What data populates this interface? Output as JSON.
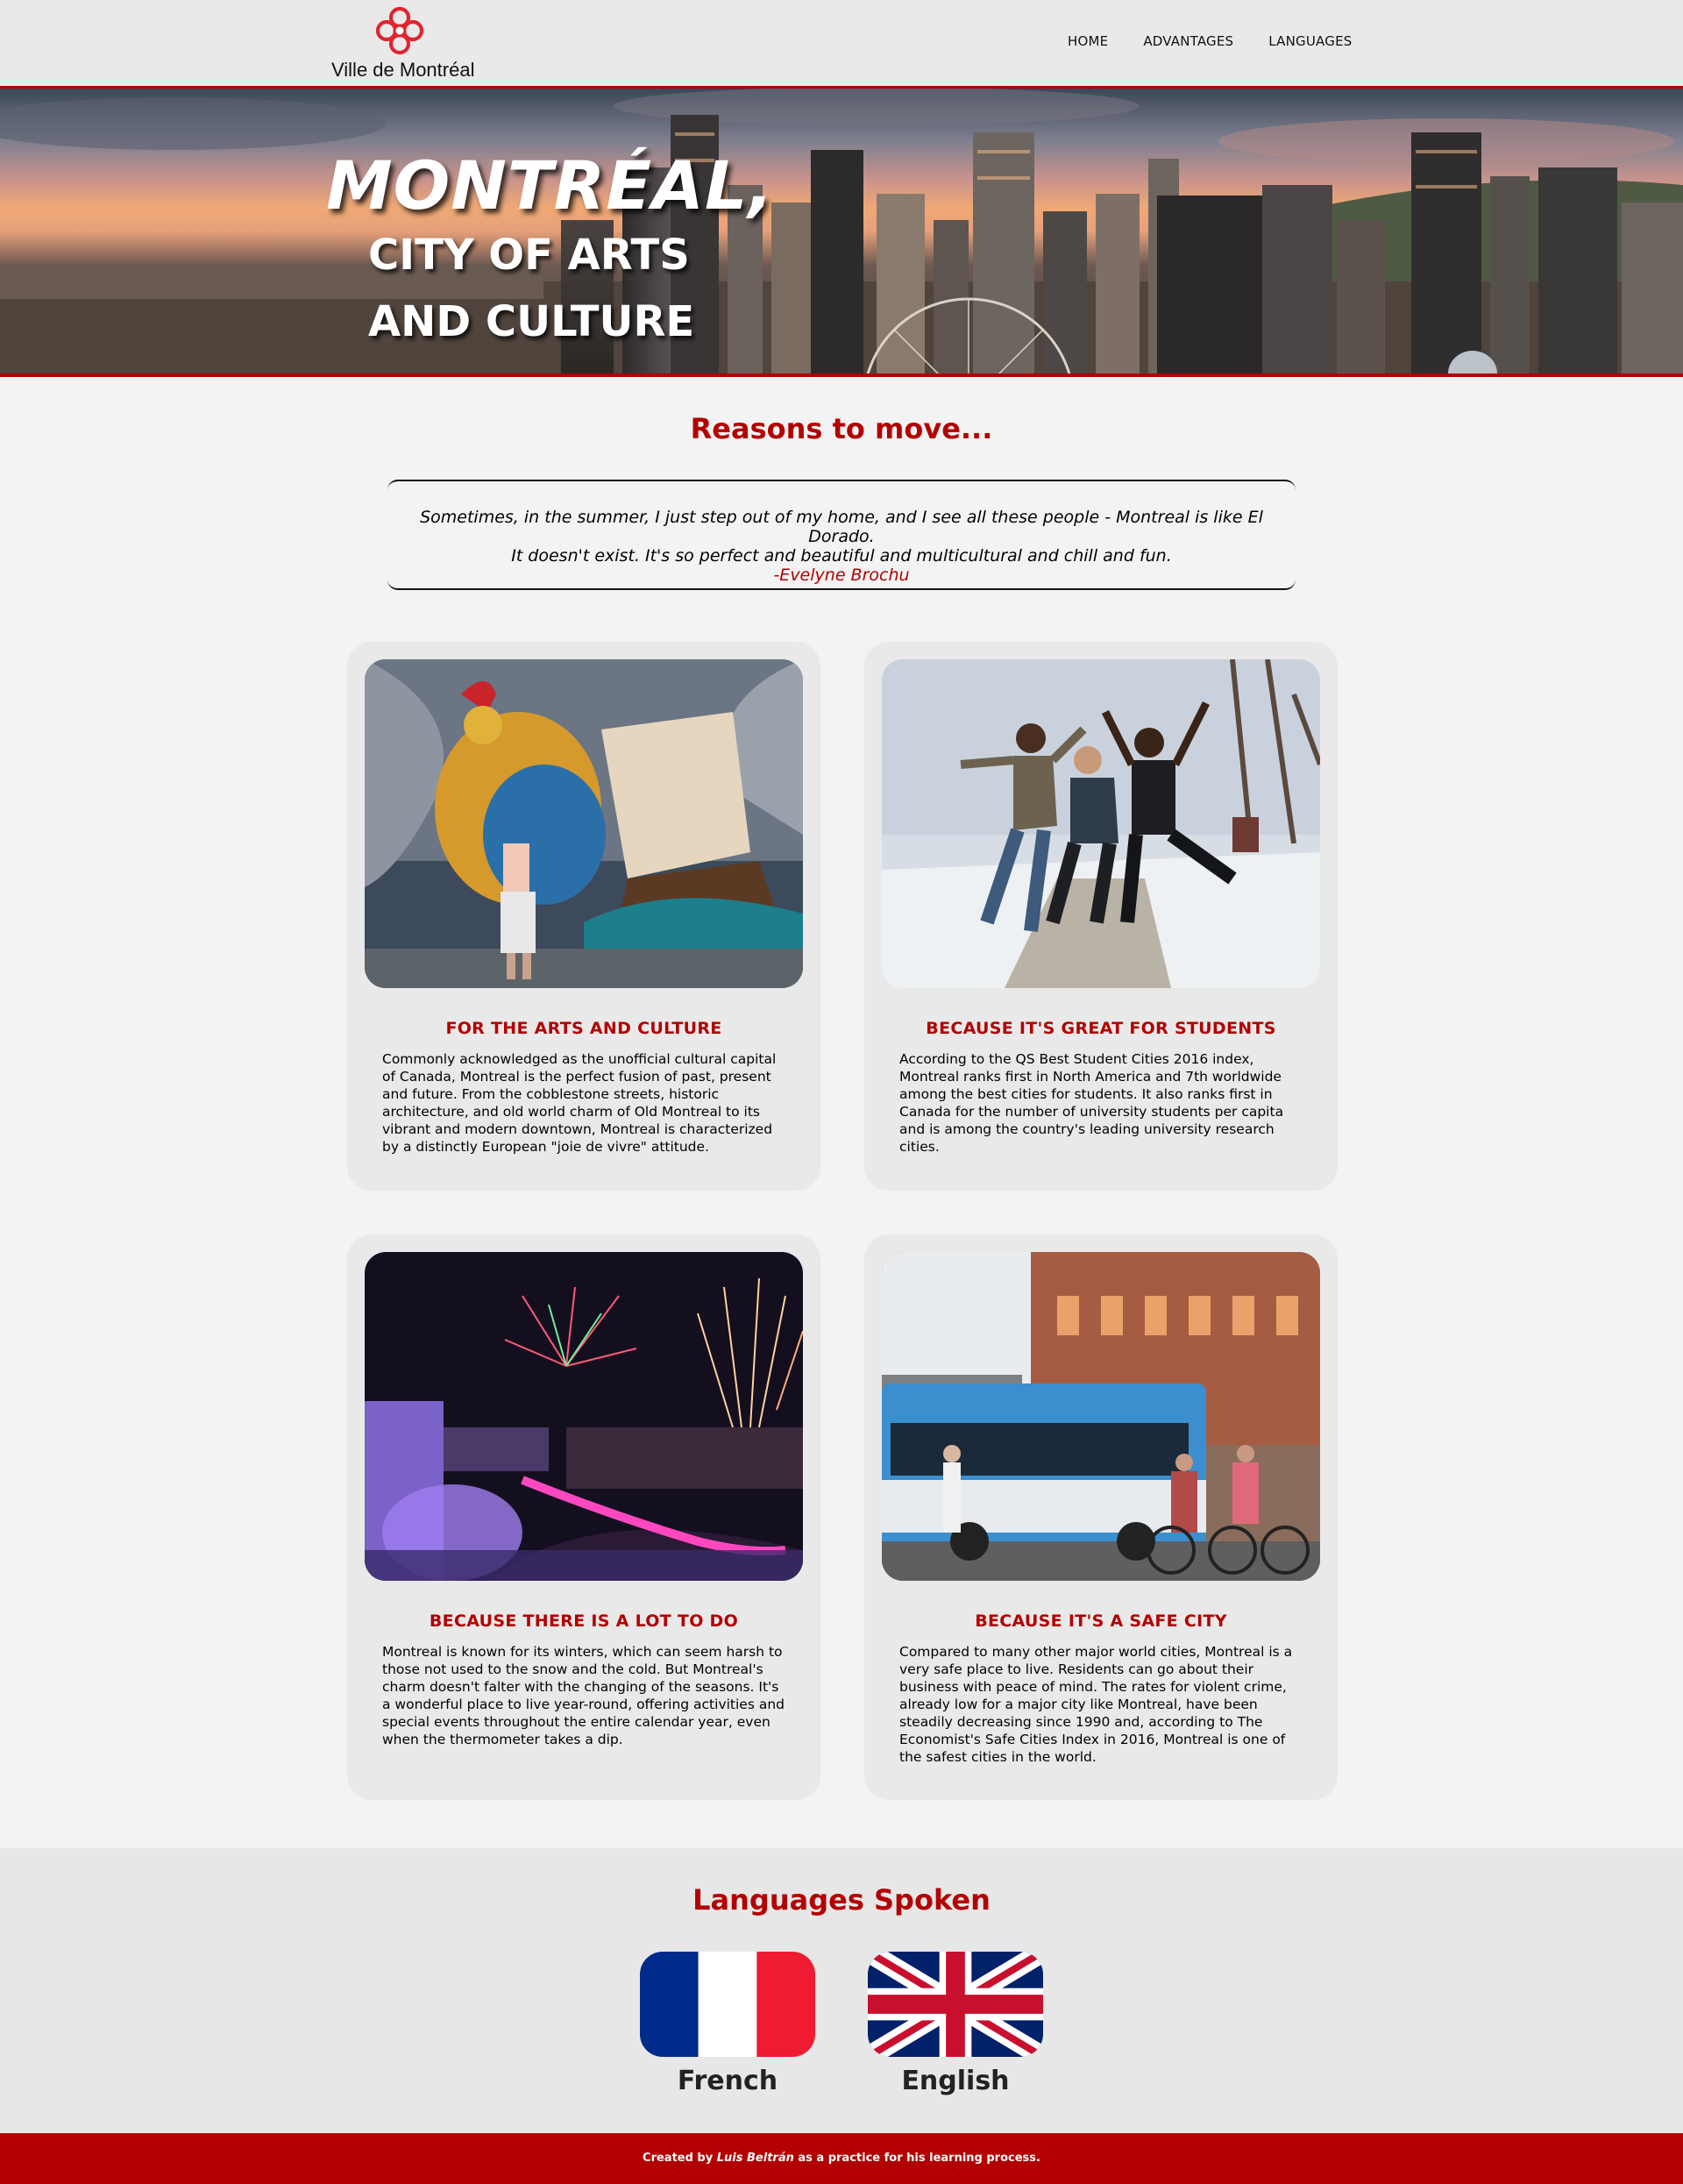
{
  "header": {
    "logo_text": "Ville de Montréal",
    "logo_icon": "rosette-icon",
    "brand_color": "#e0242f",
    "nav": [
      {
        "label": "HOME"
      },
      {
        "label": "ADVANTAGES"
      },
      {
        "label": "LANGUAGES"
      }
    ]
  },
  "hero": {
    "title": "MONTRÉAL,",
    "subtitle_line1": "CITY OF ARTS",
    "subtitle_line2": "AND CULTURE",
    "image": "montreal-skyline-sunset"
  },
  "reasons": {
    "title": "Reasons to move...",
    "quote": {
      "line1": "Sometimes, in the summer, I just step out of my home, and I see all these people - Montreal is like El Dorado.",
      "line2": "It doesn't exist. It's so perfect and beautiful and multicultural and chill and fun.",
      "author": "-Evelyne Brochu"
    },
    "cards": [
      {
        "title": "FOR THE ARTS AND CULTURE",
        "text": "Commonly acknowledged as the unofficial cultural capital of Canada, Montreal is the perfect fusion of past, present and future. From the cobblestone streets, historic architecture, and old world charm of Old Montreal to its vibrant and modern downtown, Montreal is characterized by a distinctly European \"joie de vivre\" attitude.",
        "image": "street-art-mural"
      },
      {
        "title": "BECAUSE IT'S GREAT FOR STUDENTS",
        "text": "According to the QS Best Student Cities 2016 index, Montreal ranks first in North America and 7th worldwide among the best cities for students. It also ranks first in Canada for the number of university students per capita and is among the country's leading university research cities.",
        "image": "students-jumping"
      },
      {
        "title": "BECAUSE THERE IS A LOT TO DO",
        "text": "Montreal is known for its winters, which can seem harsh to those not used to the snow and the cold. But Montreal's charm doesn't falter with the changing of the seasons. It's a wonderful place to live year-round, offering activities and special events throughout the entire calendar year, even when the thermometer takes a dip.",
        "image": "festival-fireworks"
      },
      {
        "title": "BECAUSE IT'S A SAFE CITY",
        "text": "Compared to many other major world cities, Montreal is a very safe place to live. Residents can go about their business with peace of mind. The rates for violent crime, already low for a major city like Montreal, have been steadily decreasing since 1990 and, according to The Economist's Safe Cities Index in 2016, Montreal is one of the safest cities in the world.",
        "image": "city-street-bus-cyclists"
      }
    ]
  },
  "languages": {
    "title": "Languages Spoken",
    "items": [
      {
        "label": "French",
        "flag": "france-flag"
      },
      {
        "label": "English",
        "flag": "uk-flag"
      }
    ]
  },
  "footer": {
    "prefix": "Created by ",
    "author": "Luis Beltrán",
    "suffix": " as a practice for his learning process."
  },
  "colors": {
    "accent": "#b30000",
    "header_bg": "#e9e9e9",
    "page_bg": "#f3f3f3",
    "card_bg": "#e9e9e9"
  }
}
